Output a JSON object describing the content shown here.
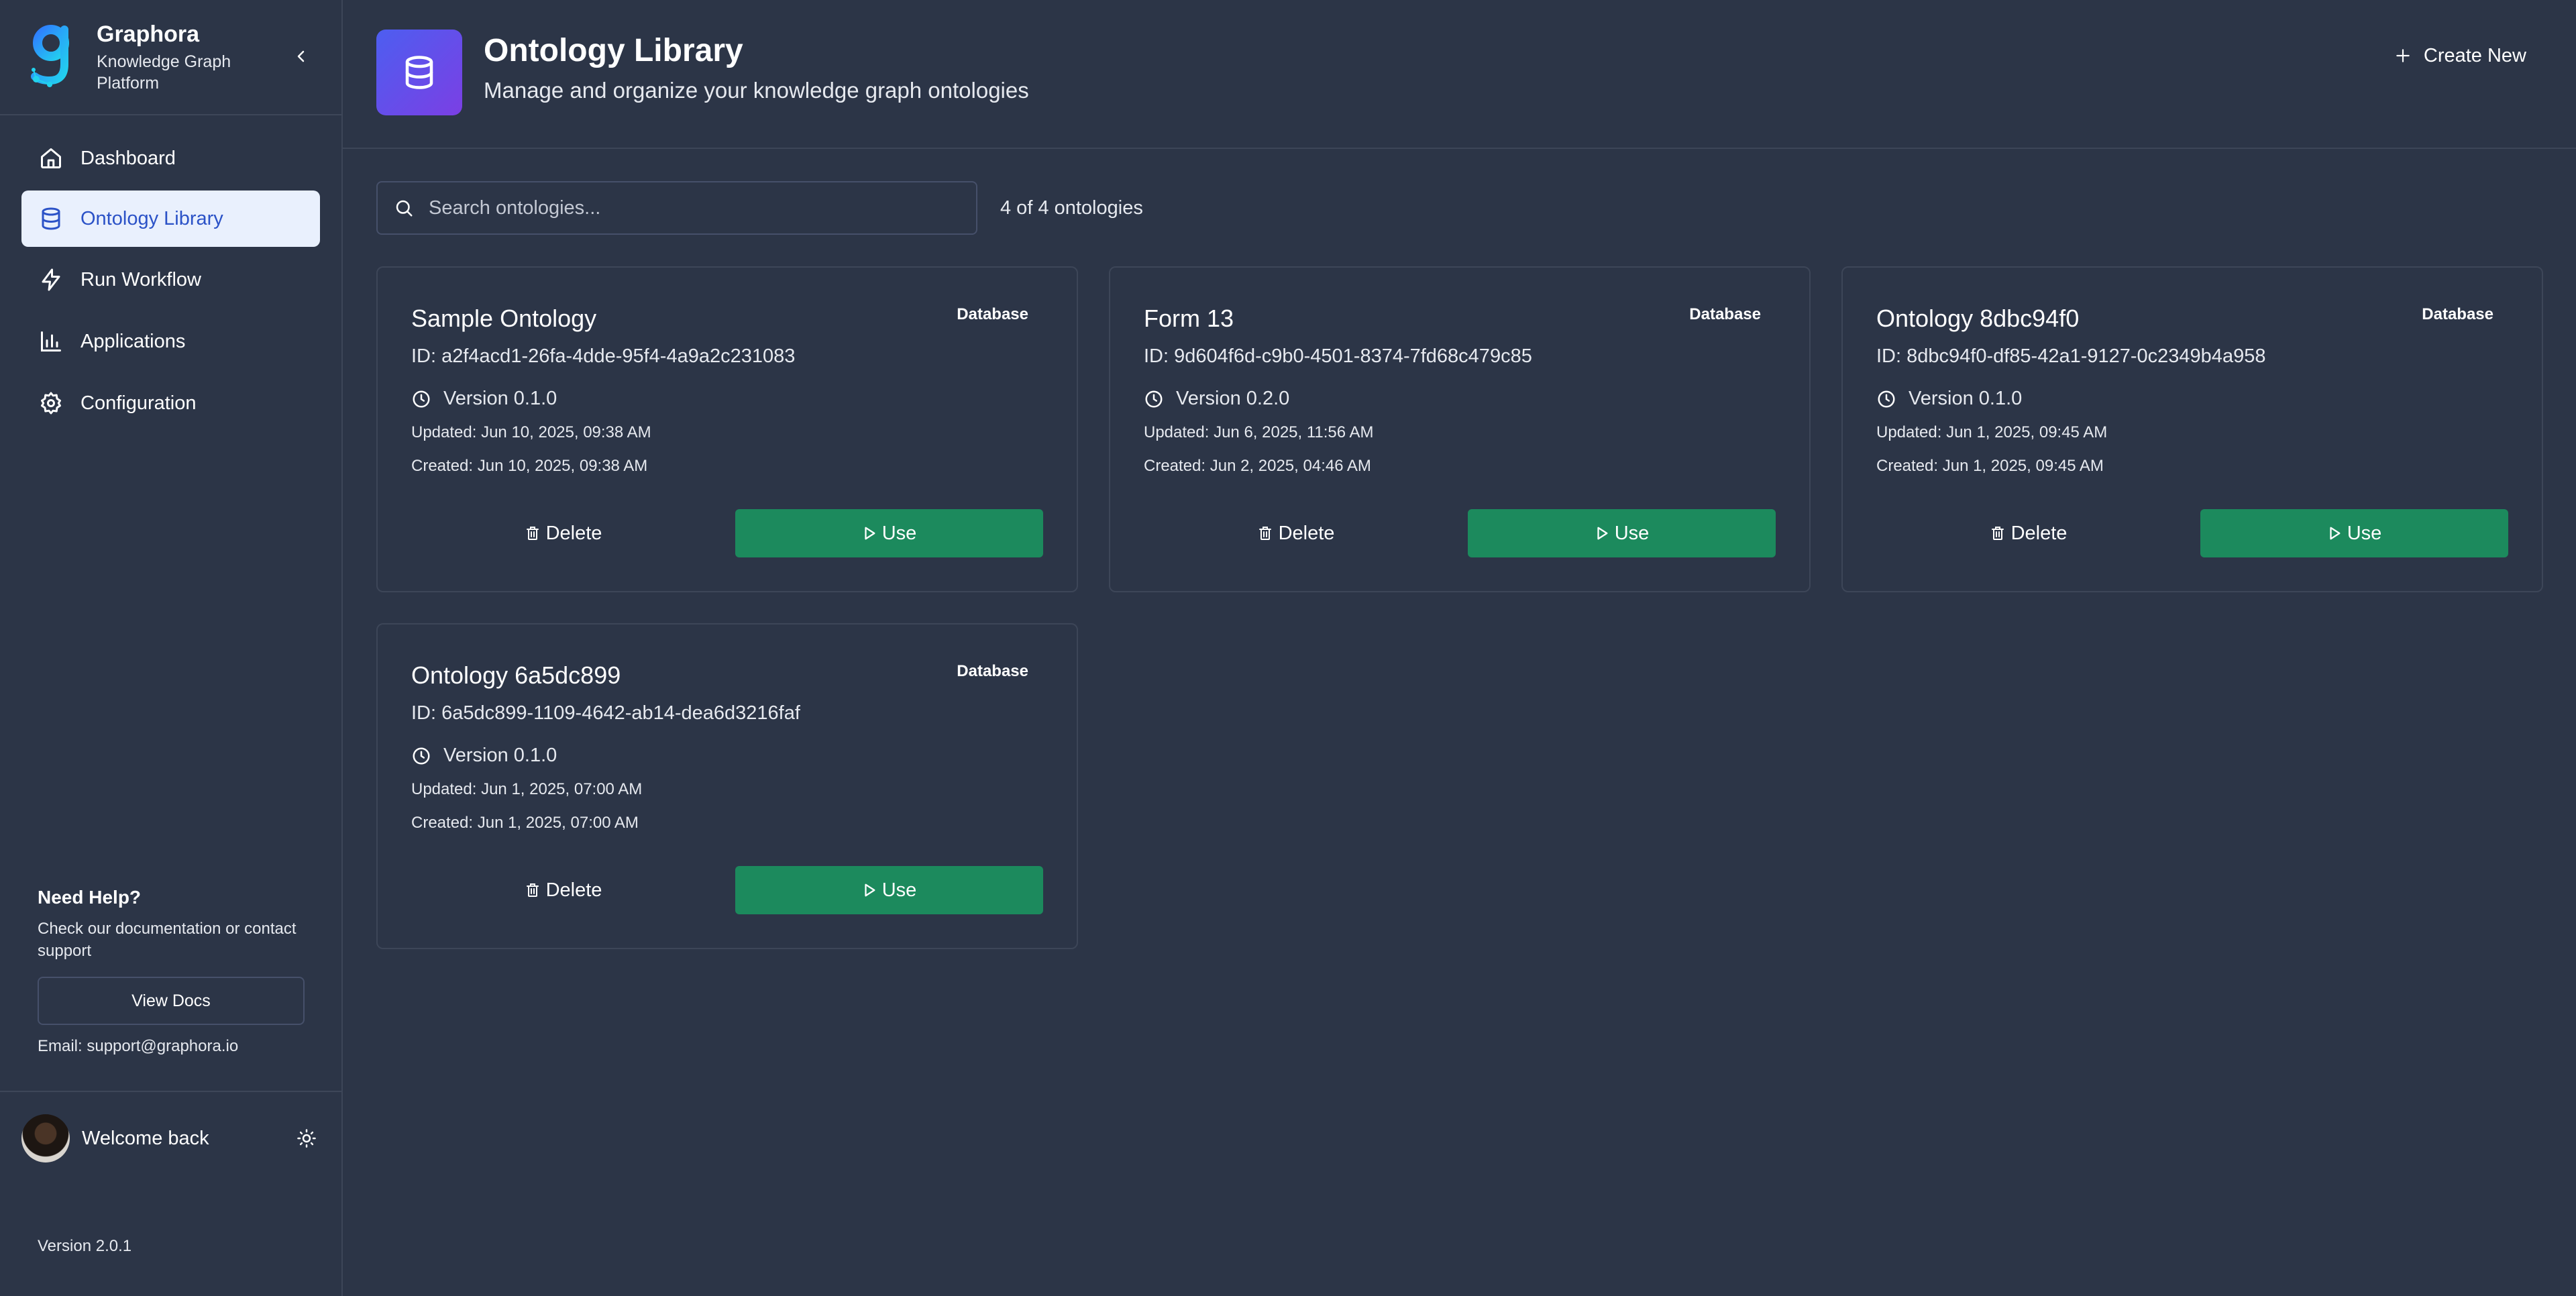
{
  "brand": {
    "name": "Graphora",
    "subtitle": "Knowledge Graph Platform",
    "logo_icon": "graphora-logo-icon",
    "collapse_icon": "chevron-left-icon"
  },
  "sidebar": {
    "items": [
      {
        "label": "Dashboard",
        "icon": "home-icon",
        "active": false
      },
      {
        "label": "Ontology Library",
        "icon": "database-icon",
        "active": true
      },
      {
        "label": "Run Workflow",
        "icon": "lightning-icon",
        "active": false
      },
      {
        "label": "Applications",
        "icon": "bar-chart-icon",
        "active": false
      },
      {
        "label": "Configuration",
        "icon": "gear-icon",
        "active": false
      }
    ],
    "help": {
      "title": "Need Help?",
      "text": "Check our documentation or contact support",
      "button_label": "View Docs",
      "email": "Email: support@graphora.io"
    },
    "user": {
      "welcome": "Welcome back",
      "theme_icon": "sun-icon"
    },
    "version": "Version 2.0.1"
  },
  "header": {
    "title": "Ontology Library",
    "subtitle": "Manage and organize your knowledge graph ontologies",
    "icon": "database-icon",
    "create_label": "Create New"
  },
  "search": {
    "placeholder": "Search ontologies...",
    "value": "",
    "count_text": "4 of 4 ontologies"
  },
  "colors": {
    "background": "#2c3547",
    "border": "#3d4658",
    "accent_active_bg": "#e9f0fd",
    "accent_active_text": "#2b52c7",
    "use_button": "#1c8a5d",
    "header_icon_gradient_start": "#4d5ef0",
    "header_icon_gradient_end": "#7b3fe4"
  },
  "cards": [
    {
      "name": "Sample Ontology",
      "badge": "Database",
      "id": "ID: a2f4acd1-26fa-4dde-95f4-4a9a2c231083",
      "version": "Version 0.1.0",
      "updated": "Updated: Jun 10, 2025, 09:38 AM",
      "created": "Created: Jun 10, 2025, 09:38 AM",
      "delete_label": "Delete",
      "use_label": "Use"
    },
    {
      "name": "Form 13",
      "badge": "Database",
      "id": "ID: 9d604f6d-c9b0-4501-8374-7fd68c479c85",
      "version": "Version 0.2.0",
      "updated": "Updated: Jun 6, 2025, 11:56 AM",
      "created": "Created: Jun 2, 2025, 04:46 AM",
      "delete_label": "Delete",
      "use_label": "Use"
    },
    {
      "name": "Ontology 8dbc94f0",
      "badge": "Database",
      "id": "ID: 8dbc94f0-df85-42a1-9127-0c2349b4a958",
      "version": "Version 0.1.0",
      "updated": "Updated: Jun 1, 2025, 09:45 AM",
      "created": "Created: Jun 1, 2025, 09:45 AM",
      "delete_label": "Delete",
      "use_label": "Use"
    },
    {
      "name": "Ontology 6a5dc899",
      "badge": "Database",
      "id": "ID: 6a5dc899-1109-4642-ab14-dea6d3216faf",
      "version": "Version 0.1.0",
      "updated": "Updated: Jun 1, 2025, 07:00 AM",
      "created": "Created: Jun 1, 2025, 07:00 AM",
      "delete_label": "Delete",
      "use_label": "Use"
    }
  ]
}
